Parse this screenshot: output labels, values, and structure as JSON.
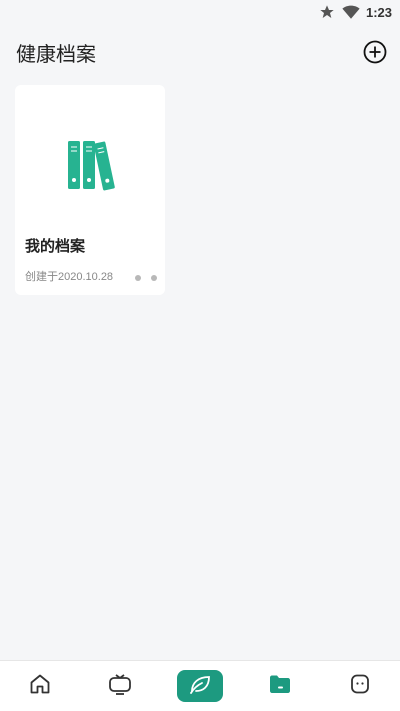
{
  "status_bar": {
    "time": "1:23",
    "icons": [
      "star-icon",
      "wifi-icon"
    ]
  },
  "header": {
    "title": "健康档案",
    "add_icon": "add-circle-icon"
  },
  "cards": [
    {
      "name": "我的档案",
      "created": "创建于2020.10.28",
      "illustration": "binders-icon",
      "more_icon": "more-dots-icon"
    }
  ],
  "tabbar": {
    "items": [
      {
        "icon": "home-icon",
        "active": false
      },
      {
        "icon": "tv-icon",
        "active": false
      },
      {
        "icon": "leaf-icon",
        "active": true
      },
      {
        "icon": "folder-icon",
        "active": false
      },
      {
        "icon": "face-icon",
        "active": false
      }
    ]
  },
  "colors": {
    "accent": "#1d9a80",
    "binder": "#27b391",
    "background": "#f5f6f8"
  }
}
